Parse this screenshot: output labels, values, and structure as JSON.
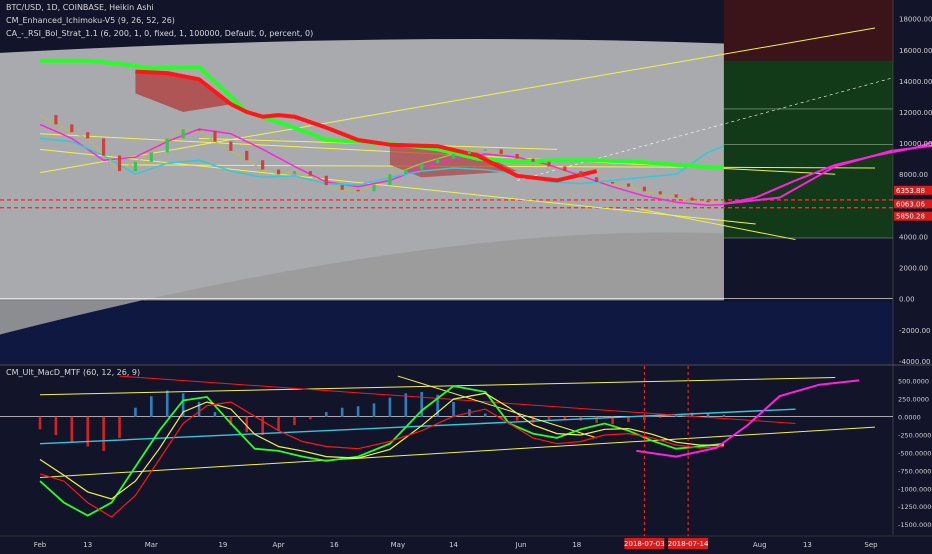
{
  "header": {
    "symbol_line": "BTC/USD, 1D, COINBASE, Heikin Ashi",
    "ichimoku_line": "CM_Enhanced_Ichimoku-V5 (9, 26, 52, 26)",
    "rsi_line": "CA_-_RSI_Bol_Strat_1.1 (6, 200, 1, 0, fixed, 1, 100000, Default, 0, percent, 0)",
    "macd_line": "CM_Ult_MacD_MTF (60, 12, 26, 9)"
  },
  "colors": {
    "background": "#12142a",
    "volume_zone": "#0f1840",
    "green_zone": "#123a18",
    "cloud_fill": "#c4c4c4",
    "green_line": "#26ff26",
    "red_line": "#ff1616",
    "magenta": "#ff22dd",
    "yellow": "#f2f24a",
    "cyan": "#32c8dc",
    "macd_hist_up": "#2f7fbf",
    "macd_hist_down": "#d82020",
    "dashed_red": "#ff2a2a"
  },
  "chart_data": [
    {
      "type": "line",
      "title": "BTC/USD, 1D, COINBASE, Heikin Ashi",
      "y_ticks": [
        "18000.00",
        "16000.00",
        "14000.00",
        "12000.00",
        "10000.00",
        "8000.00",
        "6000.00",
        "4000.00",
        "2000.00",
        "0.00",
        "-2000.00",
        "-4000.00"
      ],
      "ylim": [
        -4200,
        19200
      ],
      "price_labels": [
        {
          "value": 6353.88,
          "label": "6353.88"
        },
        {
          "value": 6063.06,
          "label": "6063.06"
        },
        {
          "value": 5850.28,
          "label": "5850.28"
        }
      ],
      "series": [
        {
          "kind": "price",
          "x": [
            0,
            4,
            8,
            12,
            16,
            20,
            24,
            28,
            32,
            36,
            40,
            44,
            48,
            52,
            56,
            60,
            64,
            68,
            72,
            76,
            80,
            84,
            88,
            92,
            96,
            100,
            104,
            108,
            112,
            116,
            120,
            124,
            128,
            132,
            136,
            140,
            144,
            148,
            152,
            156,
            160,
            164,
            168,
            172
          ],
          "y": [
            11800,
            11200,
            10700,
            10300,
            9200,
            8200,
            8800,
            9400,
            10300,
            10900,
            10800,
            10100,
            9500,
            8900,
            8300,
            8000,
            8200,
            7900,
            7300,
            7000,
            6900,
            7300,
            8000,
            8300,
            8700,
            9000,
            9300,
            9500,
            9600,
            9300,
            9000,
            8800,
            8500,
            8200,
            7800,
            7500,
            7400,
            7200,
            6900,
            6700,
            6500,
            6300,
            6200,
            6250
          ]
        },
        {
          "kind": "magenta",
          "x": [
            0,
            8,
            16,
            24,
            32,
            40,
            48,
            56,
            64,
            72,
            80,
            88,
            96,
            104,
            112,
            120,
            128,
            136,
            144,
            152,
            160,
            168,
            172
          ],
          "y": [
            11200,
            10300,
            8900,
            9100,
            10100,
            10900,
            10600,
            9600,
            8500,
            7500,
            7200,
            7600,
            8400,
            9000,
            9300,
            9100,
            8600,
            7900,
            7200,
            6600,
            6200,
            6000,
            6050
          ]
        },
        {
          "kind": "cyan",
          "x": [
            0,
            8,
            16,
            24,
            32,
            40,
            48,
            56,
            64,
            72,
            80,
            88,
            96,
            104,
            112,
            120,
            128,
            136,
            144,
            152,
            160,
            168,
            172
          ],
          "y": [
            10300,
            10100,
            9200,
            8000,
            8700,
            8900,
            8200,
            7800,
            7900,
            7400,
            7300,
            7800,
            8200,
            8400,
            8300,
            8000,
            7500,
            7400,
            7600,
            7800,
            8000,
            9400,
            9800
          ]
        },
        {
          "kind": "green",
          "x": [
            0,
            12,
            20,
            28,
            40,
            52,
            64,
            72,
            80,
            90,
            100,
            110,
            120,
            130,
            140,
            150,
            160,
            172
          ],
          "y": [
            15300,
            15300,
            15100,
            14800,
            14900,
            12000,
            11000,
            10200,
            10100,
            9900,
            9600,
            9000,
            8800,
            8900,
            8900,
            8800,
            8600,
            8400
          ]
        },
        {
          "kind": "red",
          "x": [
            24,
            32,
            40,
            48,
            52,
            56,
            60,
            64,
            72,
            80,
            88,
            100,
            110,
            120,
            130,
            140
          ],
          "y": [
            14600,
            14500,
            14100,
            12500,
            12000,
            11700,
            11800,
            11700,
            11000,
            10200,
            9900,
            9800,
            9200,
            7900,
            7600,
            8200
          ]
        }
      ],
      "projections": [
        {
          "kind": "magenta",
          "x": [
            172,
            180,
            190,
            200,
            210,
            220,
            230,
            240,
            246
          ],
          "y": [
            6100,
            6500,
            7600,
            8600,
            9200,
            9700,
            10500,
            11800,
            11500
          ]
        },
        {
          "kind": "magenta",
          "x": [
            172,
            186,
            200,
            214,
            230,
            246
          ],
          "y": [
            6100,
            6500,
            8500,
            9500,
            10000,
            10800
          ]
        }
      ]
    },
    {
      "type": "bar",
      "title": "CM_Ult_MacD_MTF (60, 12, 26, 9)",
      "y_ticks": [
        "500.0000",
        "250.0000",
        "0.0000",
        "-250.0000",
        "-500.0000",
        "-750.0000",
        "-1000.0000",
        "-1250.0000",
        "-1500.0000"
      ],
      "ylim": [
        -1650,
        700
      ],
      "histogram": {
        "x": [
          0,
          4,
          8,
          12,
          16,
          20,
          24,
          28,
          32,
          36,
          40,
          44,
          48,
          52,
          56,
          60,
          64,
          68,
          72,
          76,
          80,
          84,
          88,
          92,
          96,
          100,
          104,
          108,
          112,
          116,
          120,
          124,
          128,
          132,
          136,
          140,
          144,
          148,
          152,
          156,
          160,
          164,
          168,
          172
        ],
        "values": [
          -180,
          -260,
          -350,
          -420,
          -480,
          -300,
          120,
          280,
          360,
          320,
          200,
          60,
          -120,
          -220,
          -260,
          -200,
          -120,
          -40,
          60,
          120,
          140,
          180,
          260,
          320,
          340,
          300,
          200,
          100,
          40,
          -30,
          -60,
          -90,
          -50,
          -40,
          -60,
          -90,
          -110,
          -80,
          -50,
          -20,
          30,
          50,
          40,
          20
        ]
      },
      "series": [
        {
          "kind": "green",
          "x": [
            0,
            6,
            12,
            18,
            24,
            30,
            36,
            42,
            48,
            54,
            60,
            66,
            72,
            80,
            88,
            96,
            104,
            112,
            118,
            124,
            130,
            136,
            142,
            148,
            154,
            160,
            166,
            172
          ],
          "y": [
            -900,
            -1200,
            -1380,
            -1200,
            -700,
            -200,
            220,
            270,
            -100,
            -450,
            -480,
            -560,
            -620,
            -560,
            -380,
            80,
            420,
            340,
            -100,
            -240,
            -300,
            -180,
            -100,
            -200,
            -340,
            -450,
            -420,
            -380
          ]
        },
        {
          "kind": "yellow",
          "x": [
            0,
            6,
            12,
            18,
            24,
            30,
            36,
            42,
            48,
            54,
            60,
            66,
            72,
            80,
            88,
            96,
            104,
            112,
            118,
            124,
            130,
            136,
            142,
            148,
            154,
            160,
            166,
            172
          ],
          "y": [
            -600,
            -820,
            -1050,
            -1150,
            -900,
            -450,
            60,
            200,
            100,
            -250,
            -420,
            -480,
            -560,
            -580,
            -460,
            -130,
            240,
            320,
            120,
            -120,
            -240,
            -260,
            -180,
            -170,
            -250,
            -360,
            -400,
            -400
          ]
        },
        {
          "kind": "red",
          "x": [
            0,
            6,
            12,
            18,
            24,
            30,
            36,
            42,
            48,
            54,
            60,
            66,
            72,
            80,
            88,
            96,
            104,
            112,
            118,
            124,
            130,
            136,
            142,
            148,
            154,
            160,
            166,
            172
          ],
          "y": [
            -800,
            -900,
            -1200,
            -1400,
            -1100,
            -600,
            -100,
            150,
            200,
            0,
            -200,
            -350,
            -420,
            -450,
            -350,
            -200,
            0,
            100,
            -100,
            -300,
            -380,
            -350,
            -260,
            -240,
            -300,
            -400,
            -440,
            -420
          ]
        }
      ],
      "projections": [
        {
          "kind": "magenta",
          "x": [
            150,
            160,
            170,
            178,
            186,
            196,
            206
          ],
          "y": [
            -480,
            -560,
            -440,
            -120,
            280,
            440,
            500
          ]
        }
      ]
    }
  ],
  "x_axis": {
    "ticks": [
      {
        "label": "Feb",
        "x": 0
      },
      {
        "label": "13",
        "x": 12
      },
      {
        "label": "Mar",
        "x": 28
      },
      {
        "label": "19",
        "x": 46
      },
      {
        "label": "Apr",
        "x": 60
      },
      {
        "label": "16",
        "x": 74
      },
      {
        "label": "May",
        "x": 90
      },
      {
        "label": "14",
        "x": 104
      },
      {
        "label": "Jun",
        "x": 121
      },
      {
        "label": "18",
        "x": 135
      },
      {
        "label": "Aug",
        "x": 181
      },
      {
        "label": "13",
        "x": 193
      },
      {
        "label": "Sep",
        "x": 209
      }
    ],
    "date_markers": [
      {
        "label": "2018-07-03",
        "x": 152
      },
      {
        "label": "2018-07-14",
        "x": 163
      }
    ]
  }
}
